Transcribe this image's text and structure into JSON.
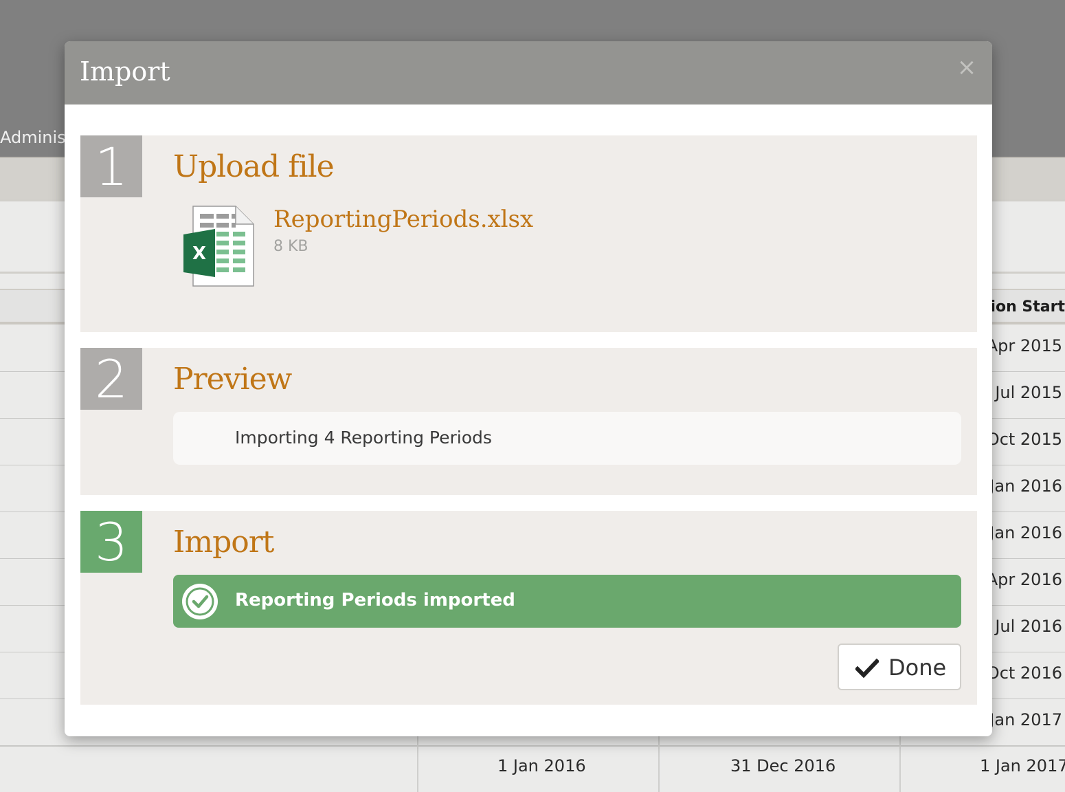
{
  "background": {
    "nav_partial": "Adminis",
    "column_header_partial": "sion Start",
    "rows": [
      "Apr 2015",
      "Jul 2015",
      "Oct 2015",
      "Jan 2016",
      "Jan 2016",
      "Apr 2016",
      "Jul 2016",
      "Oct 2016",
      "Jan 2017"
    ],
    "last_row": [
      "1 Jan 2016",
      "31 Dec 2016",
      "1 Jan 2017"
    ]
  },
  "modal": {
    "title": "Import",
    "close_glyph": "×"
  },
  "steps": [
    {
      "number": "1",
      "title": "Upload file",
      "file_name": "ReportingPeriods.xlsx",
      "file_size": "8 KB",
      "icon": "excel-file-icon"
    },
    {
      "number": "2",
      "title": "Preview",
      "message": "Importing 4 Reporting Periods"
    },
    {
      "number": "3",
      "title": "Import",
      "status": "Reporting Periods imported",
      "status_icon": "check-circle-icon",
      "done_label": "Done",
      "done_icon": "checkmark-icon"
    }
  ],
  "colors": {
    "accent": "#c07617",
    "success": "#6aa86d",
    "step_inactive": "#aeacaa",
    "step_active": "#69a96e",
    "header": "#949491"
  }
}
